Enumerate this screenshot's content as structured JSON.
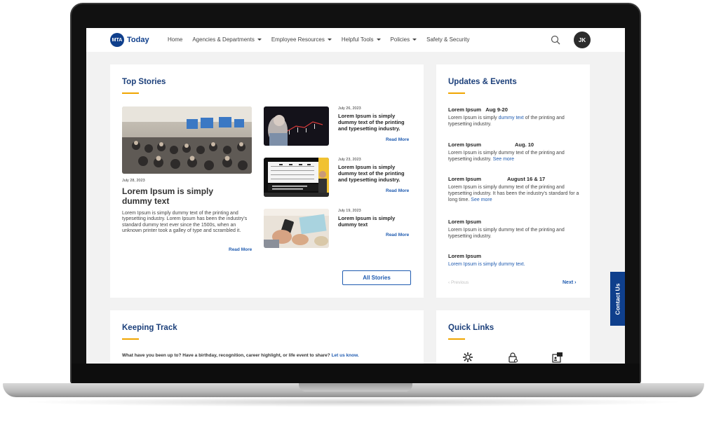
{
  "nav": {
    "logo_badge": "MTA",
    "logo_text": "Today",
    "items": [
      {
        "label": "Home",
        "dropdown": false
      },
      {
        "label": "Agencies & Departments",
        "dropdown": true
      },
      {
        "label": "Employee Resources",
        "dropdown": true
      },
      {
        "label": "Helpful Tools",
        "dropdown": true
      },
      {
        "label": "Policies",
        "dropdown": true
      },
      {
        "label": "Safety & Security",
        "dropdown": false
      }
    ],
    "avatar_initials": "JK"
  },
  "top_stories": {
    "title": "Top Stories",
    "featured": {
      "date": "July 28, 2023",
      "headline": "Lorem Ipsum is simply dummy text",
      "body": "Lorem Ipsum is simply dummy text of the printing and typesetting industry. Lorem Ipsum has been the industry's standard dummy text ever since the 1500s, when an unknown printer took a galley of type and scrambled it.",
      "read_more": "Read More"
    },
    "stories": [
      {
        "date": "July 26, 2023",
        "title": "Lorem Ipsum is simply dummy text of the printing and typesetting industry.",
        "read_more": "Read More"
      },
      {
        "date": "July 23, 2023",
        "title": "Lorem Ipsum is simply dummy text of the printing and typesetting industry.",
        "read_more": "Read More"
      },
      {
        "date": "July 19, 2023",
        "title": "Lorem Ipsum is simply dummy text",
        "read_more": "Read More"
      }
    ],
    "all_stories": "All Stories"
  },
  "updates": {
    "title": "Updates & Events",
    "events": [
      {
        "name": "Lorem Ipsum",
        "date": "Aug 9-20",
        "text_before": "Lorem Ipsum is simply ",
        "link": "dummy text",
        "text_after": " of the printing and typesetting industry."
      },
      {
        "name": "Lorem Ipsum",
        "date": "Aug. 10",
        "text_before": "Lorem Ipsum is simply dummy text of the printing and typesetting industry. ",
        "link": "See more",
        "text_after": ""
      },
      {
        "name": "Lorem Ipsum",
        "date": "August 16 & 17",
        "text_before": "Lorem Ipsum is simply dummy text of the printing and typesetting industry. It has been the industry's standard for a long time. ",
        "link": "See more",
        "text_after": ""
      },
      {
        "name": "Lorem Ipsum",
        "date": "",
        "text_before": "Lorem Ipsum is simply dummy text of the printing and typesetting industry.",
        "link": "",
        "text_after": ""
      },
      {
        "name": "Lorem Ipsum",
        "date": "",
        "text_before": "",
        "link": "Lorem Ipsum is simply dummy text.",
        "text_after": ""
      }
    ],
    "previous": "‹ Previous",
    "next": "Next ›"
  },
  "keeping_track": {
    "title": "Keeping Track",
    "prompt": "What have you been up to? Have a birthday, recognition, career highlight, or life event to share? ",
    "link": "Let us know."
  },
  "quick_links": {
    "title": "Quick Links",
    "icons": [
      "gear-icon",
      "lock-icon",
      "id-card-icon"
    ]
  },
  "contact_tab": "Contact Us",
  "colors": {
    "brand": "#0f3f8c",
    "heading": "#1b3f7a",
    "accent": "#f0a500",
    "link": "#1f5bb0"
  }
}
